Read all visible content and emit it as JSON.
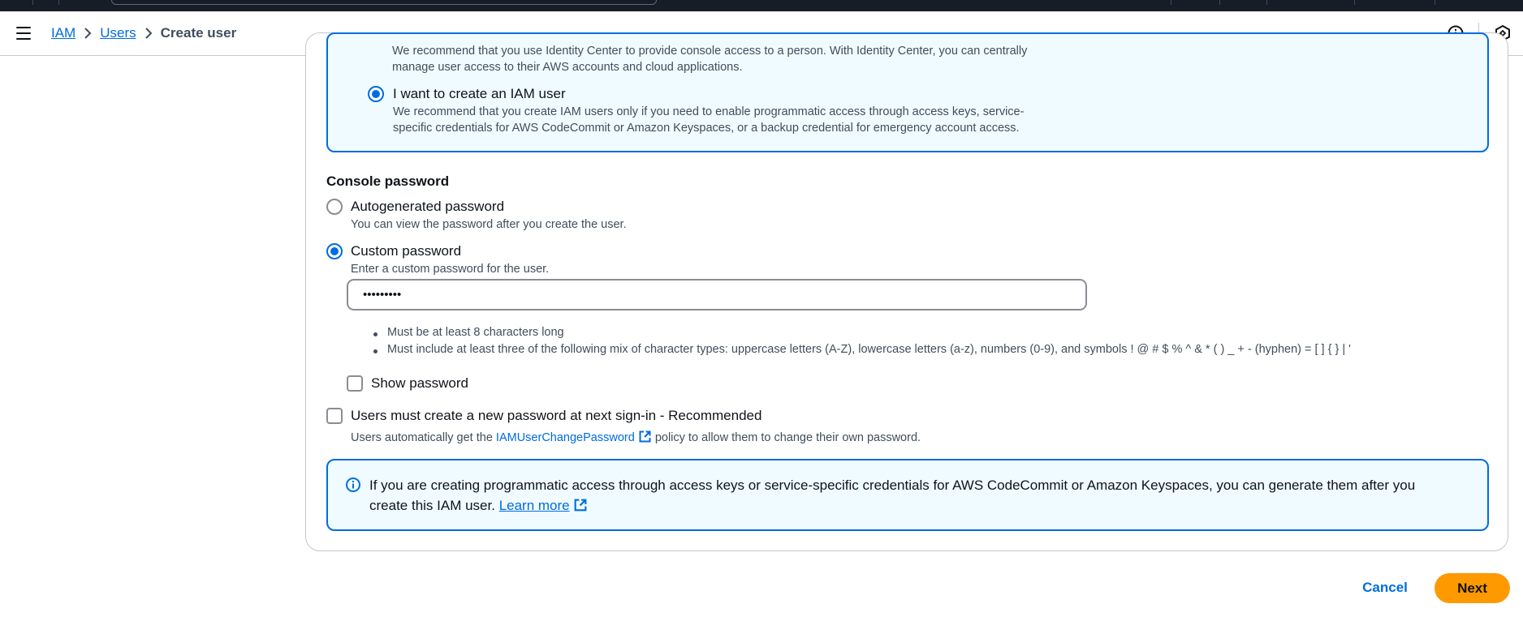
{
  "breadcrumb": {
    "items": [
      "IAM",
      "Users"
    ],
    "current": "Create user"
  },
  "access_type": {
    "faded_line_1": "We recommend that you use Identity Center to provide console access to a person. With Identity Center, you can centrally",
    "faded_line_2": "manage user access to their AWS accounts and cloud applications.",
    "iam_user_option": {
      "label": "I want to create an IAM user",
      "selected": true,
      "desc_line_1": "We recommend that you create IAM users only if you need to enable programmatic access through access keys, service-",
      "desc_line_2": "specific credentials for AWS CodeCommit or Amazon Keyspaces, or a backup credential for emergency account access."
    }
  },
  "console_password": {
    "title": "Console password",
    "autogenerated": {
      "label": "Autogenerated password",
      "desc": "You can view the password after you create the user.",
      "selected": false
    },
    "custom": {
      "label": "Custom password",
      "desc": "Enter a custom password for the user.",
      "selected": true,
      "value": "•••••••••"
    },
    "rules": [
      "Must be at least 8 characters long",
      "Must include at least three of the following mix of character types: uppercase letters (A-Z), lowercase letters (a-z), numbers (0-9), and symbols ! @ # $ % ^ & * ( ) _ + - (hyphen) = [ ] { } | '"
    ],
    "show_password": {
      "label": "Show password",
      "checked": false
    },
    "must_reset": {
      "label": "Users must create a new password at next sign-in - Recommended",
      "checked": false,
      "desc_prefix": "Users automatically get the",
      "policy_link": "IAMUserChangePassword",
      "desc_suffix": "policy to allow them to change their own password."
    }
  },
  "info_alert": {
    "text": "If you are creating programmatic access through access keys or service-specific credentials for AWS CodeCommit or Amazon Keyspaces, you can generate them after you create this IAM user.",
    "link": "Learn more"
  },
  "actions": {
    "cancel": "Cancel",
    "next": "Next"
  },
  "colors": {
    "accent": "#006ce0",
    "primary_button": "#ff9900",
    "info_bg": "#f0fbff"
  }
}
